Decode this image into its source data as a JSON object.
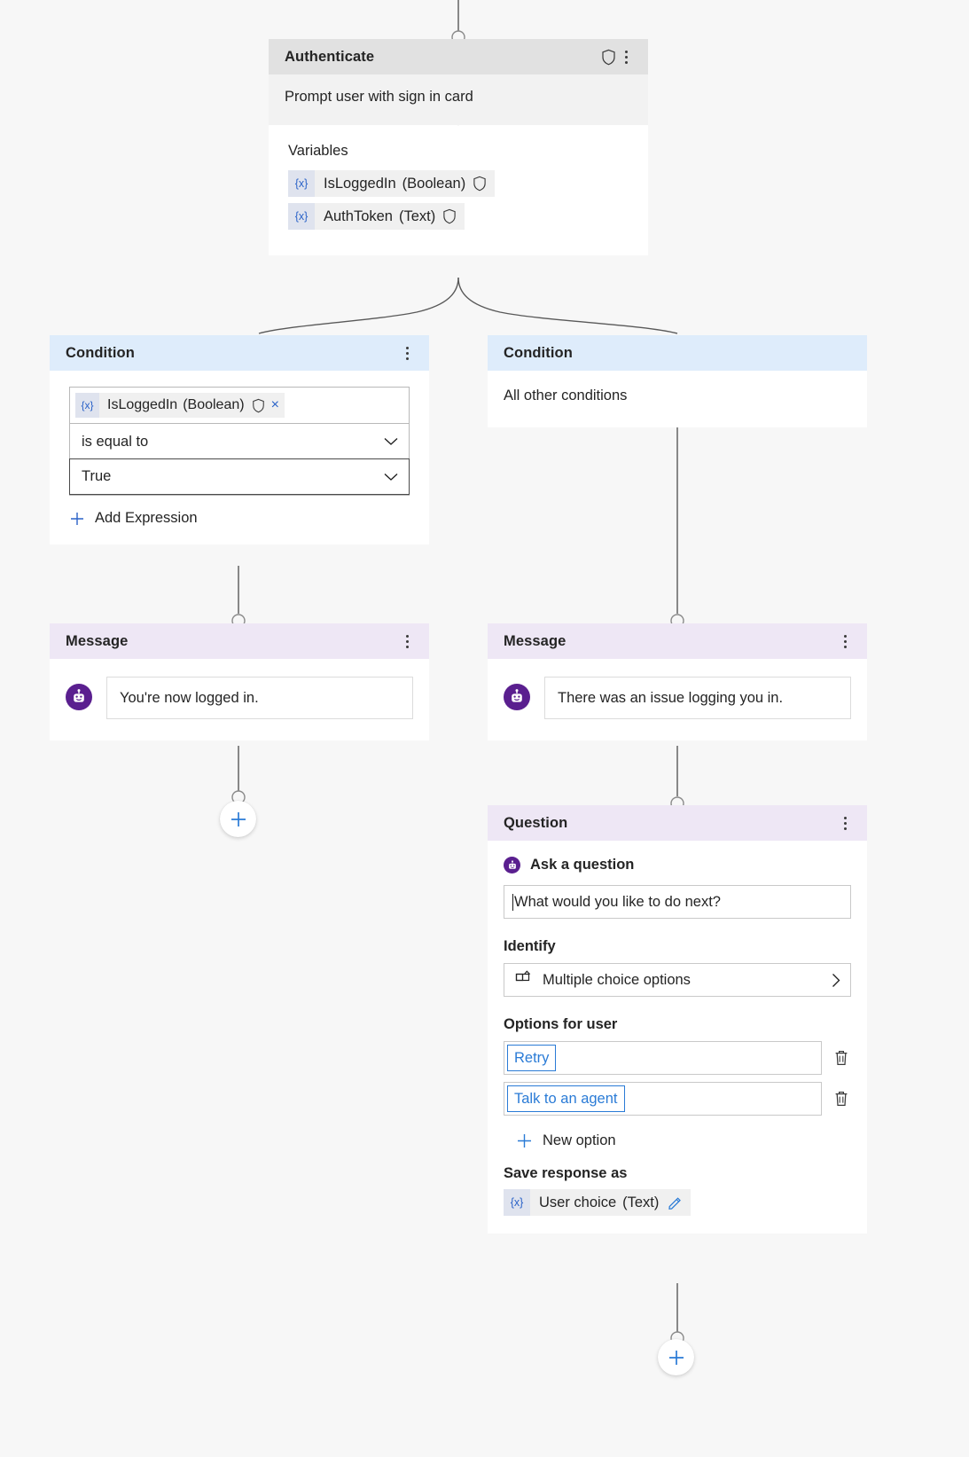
{
  "flow": {
    "authenticate": {
      "title": "Authenticate",
      "subtitle": "Prompt user with sign in card",
      "variables_label": "Variables",
      "variables": [
        {
          "token": "{x}",
          "name": "IsLoggedIn",
          "type": "(Boolean)",
          "secured": true
        },
        {
          "token": "{x}",
          "name": "AuthToken",
          "type": "(Text)",
          "secured": true
        }
      ]
    },
    "condition_left": {
      "title": "Condition",
      "variable": {
        "token": "{x}",
        "name": "IsLoggedIn",
        "type": "(Boolean)",
        "secured": true,
        "remove": "×"
      },
      "operator": "is equal to",
      "value": "True",
      "add_expression_label": "Add Expression"
    },
    "condition_right": {
      "title": "Condition",
      "body": "All other conditions"
    },
    "message_left": {
      "title": "Message",
      "text": "You're now logged in."
    },
    "message_right": {
      "title": "Message",
      "text": "There was an issue logging you in."
    },
    "question": {
      "title": "Question",
      "ask_label": "Ask a question",
      "question_text": "What would you like to do next?",
      "identify_label": "Identify",
      "identify_value": "Multiple choice options",
      "options_label": "Options for user",
      "options": [
        "Retry",
        "Talk to an agent"
      ],
      "new_option_label": "New option",
      "save_response_label": "Save response as",
      "response_variable": {
        "token": "{x}",
        "name": "User choice",
        "type": "(Text)"
      }
    },
    "add_node_left_label": "+",
    "add_node_bottom_label": "+"
  },
  "colors": {
    "canvas": "#f7f7f7",
    "authenticate_header": "#e1e1e1",
    "condition_header": "#deecfb",
    "message_header": "#eee7f5",
    "question_header": "#eee7f5",
    "accent_blue": "#2a62c8",
    "option_blue": "#2a7bd6",
    "bot_purple": "#5a1f8f",
    "wire": "#595959"
  }
}
